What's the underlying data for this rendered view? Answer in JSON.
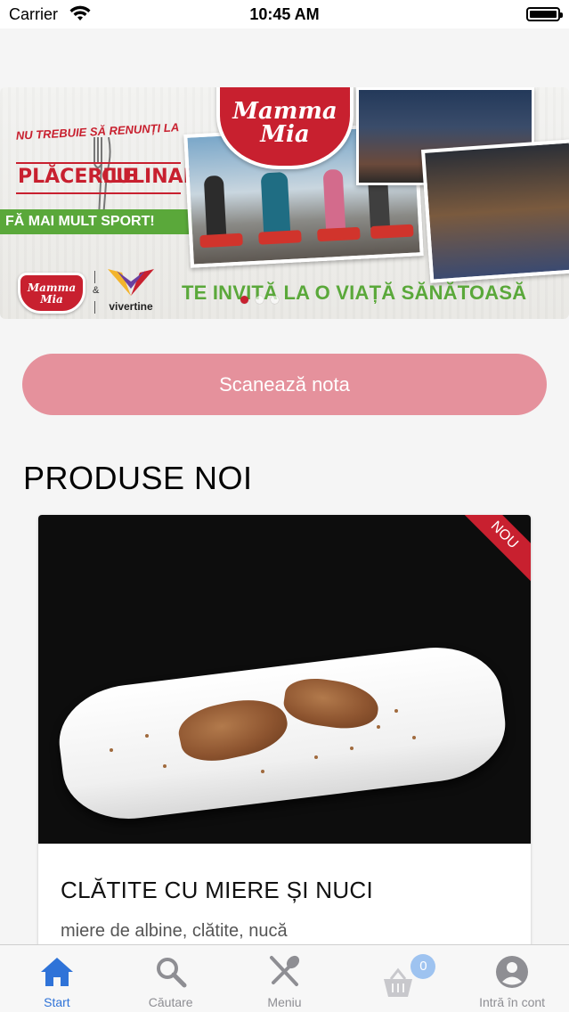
{
  "status_bar": {
    "carrier": "Carrier",
    "time": "10:45 AM"
  },
  "banner": {
    "logo_line1": "Mamma",
    "logo_line2": "Mia",
    "headline_top": "NU TREBUIE SĂ RENUNȚI LA",
    "headline_left": "PLĂCERILE",
    "headline_right": "CULINARE",
    "green_bar": "FĂ MAI MULT SPORT!",
    "small_logo_line1": "Mamma",
    "small_logo_line2": "Mia",
    "ampersand": "&",
    "partner": "vivertine",
    "slogan": "TE INVITĂ LA O VIAȚĂ SĂNĂTOASĂ",
    "slides_total": 3,
    "slide_active": 1
  },
  "scan_button": {
    "label": "Scanează nota"
  },
  "section": {
    "title": "PRODUSE NOI"
  },
  "product": {
    "badge": "NOU",
    "title": "CLĂTITE CU MIERE ȘI NUCI",
    "description": "miere de albine, clătite, nucă"
  },
  "tabbar": {
    "tabs": [
      {
        "label": "Start",
        "icon": "home-icon",
        "active": true
      },
      {
        "label": "Căutare",
        "icon": "search-icon",
        "active": false
      },
      {
        "label": "Meniu",
        "icon": "cutlery-icon",
        "active": false
      },
      {
        "label": "",
        "icon": "basket-icon",
        "active": false
      },
      {
        "label": "Intră în cont",
        "icon": "account-icon",
        "active": false
      }
    ],
    "cart_count": "0"
  },
  "colors": {
    "brand_red": "#c8202f",
    "button_pink": "#e5919c",
    "active_blue": "#2f73d8",
    "green": "#5aa83a"
  }
}
